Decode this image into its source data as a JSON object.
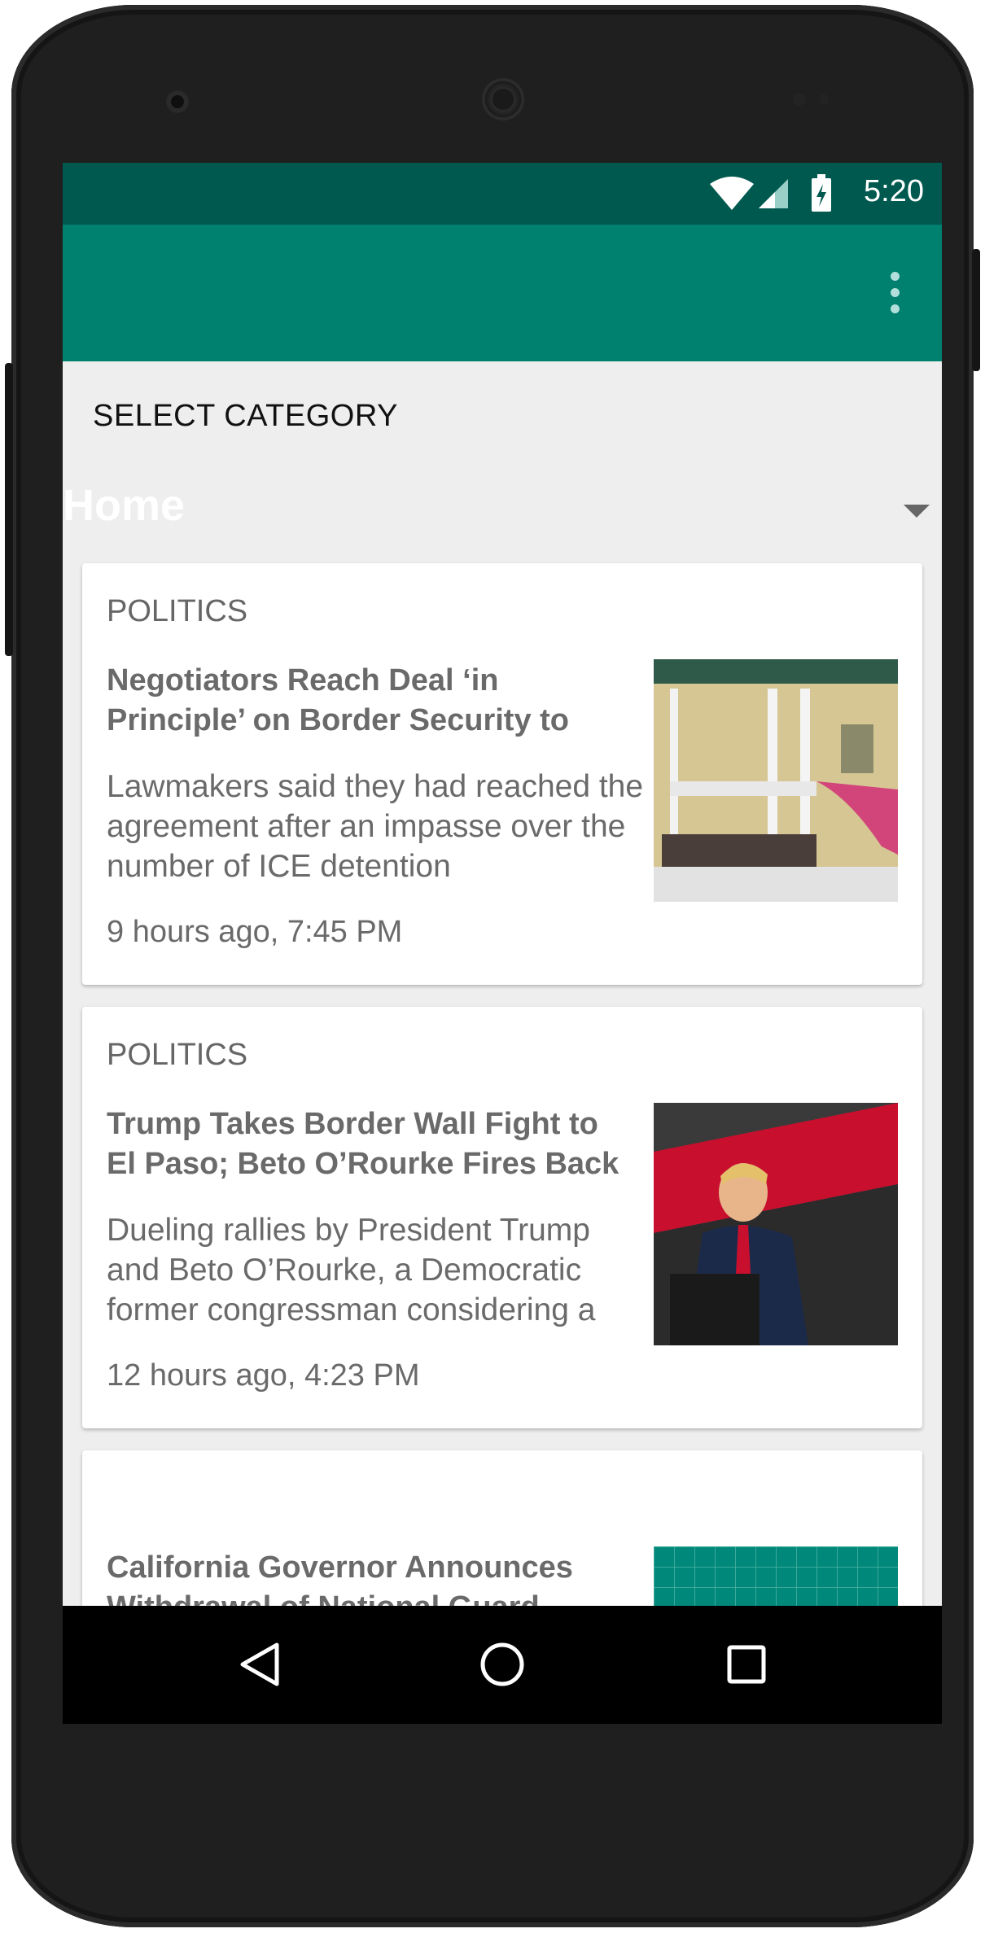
{
  "status_bar": {
    "time": "5:20",
    "icons": [
      "wifi-icon",
      "cell-signal-icon",
      "battery-charging-icon"
    ]
  },
  "app_bar": {
    "menu_icon": "overflow-menu-icon"
  },
  "category_label": "SELECT CATEGORY",
  "spinner": {
    "selected": "Home"
  },
  "articles": [
    {
      "category": "POLITICS",
      "title": "Negotiators Reach Deal ‘in Principle’ on Border Security to",
      "description": "Lawmakers said they had reached the agreement after an impasse over the number of ICE detention",
      "time": "9 hours ago, 7:45 PM",
      "image": "detention-bunk-photo"
    },
    {
      "category": "POLITICS",
      "title": "Trump Takes Border Wall Fight to El Paso; Beto O’Rourke Fires Back",
      "description": "Dueling rallies by President Trump and Beto O’Rourke, a Democratic former congressman considering a",
      "time": "12 hours ago, 4:23 PM",
      "image": "rally-speech-photo"
    },
    {
      "category": "",
      "title": "California Governor Announces Withdrawal of National Guard",
      "description": "",
      "time": "",
      "image": "teal-grid-placeholder"
    }
  ],
  "nav_bar": {
    "buttons": [
      "back-icon",
      "home-icon",
      "recents-icon"
    ]
  },
  "colors": {
    "status_bar": "#00594f",
    "app_bar": "#00806f",
    "background": "#eeeeee"
  }
}
